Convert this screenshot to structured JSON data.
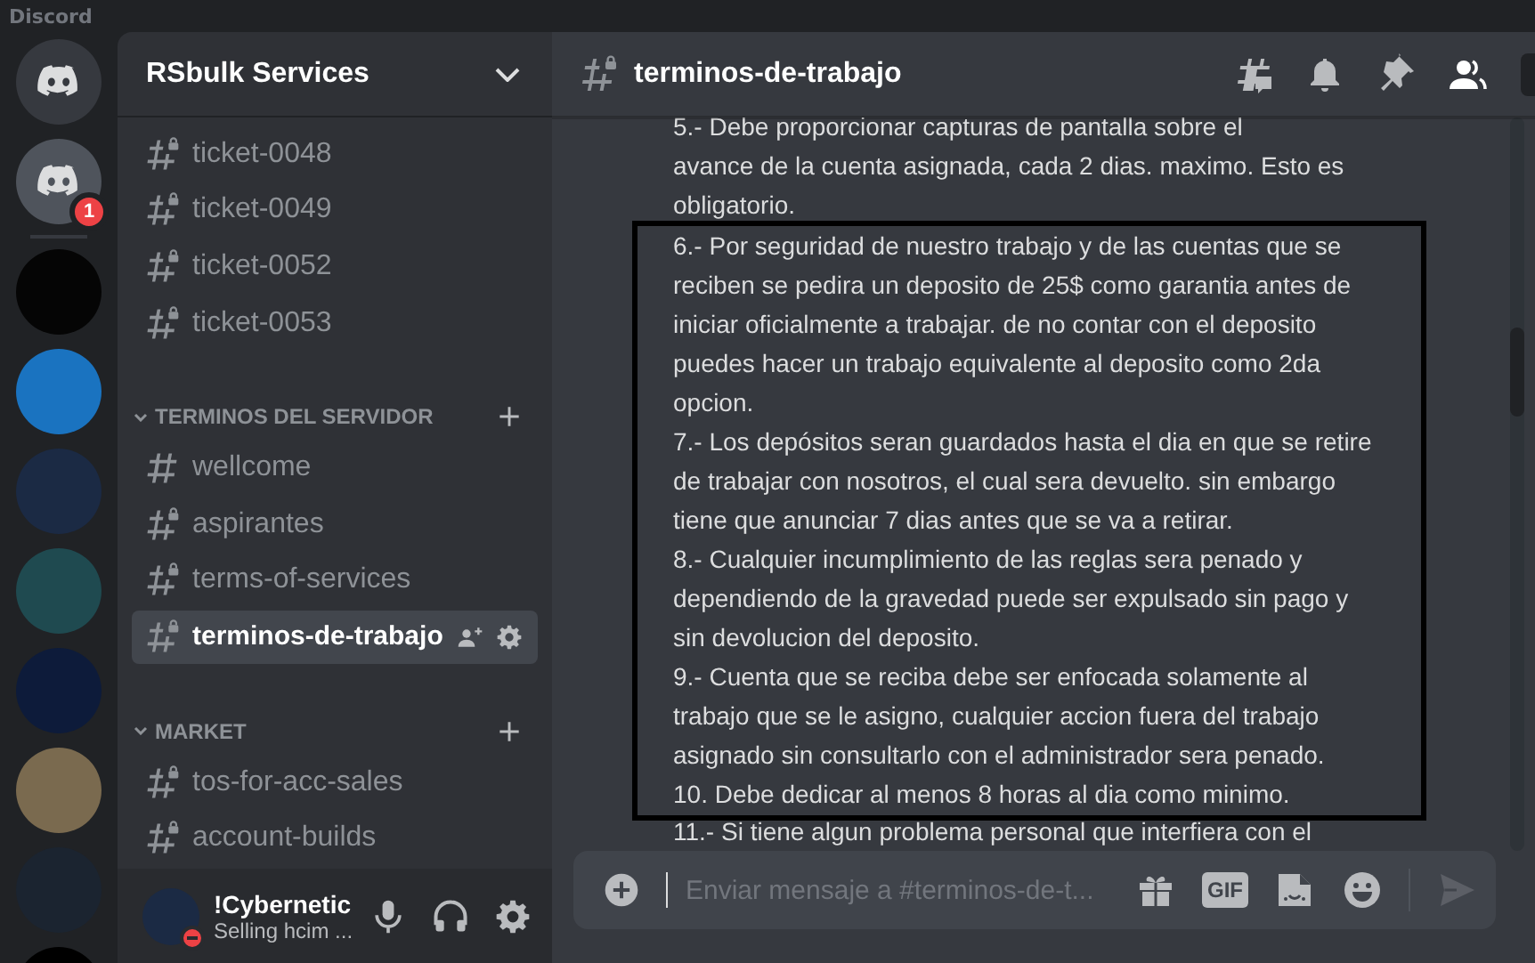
{
  "app": {
    "title": "Discord"
  },
  "servers": [
    {
      "kind": "logo"
    },
    {
      "kind": "logo",
      "badge": "1"
    },
    {
      "kind": "separator"
    },
    {
      "kind": "picture",
      "color": "#050505"
    },
    {
      "kind": "picture",
      "color": "#1a73c0"
    },
    {
      "kind": "picture",
      "color": "#1b2a44"
    },
    {
      "kind": "picture",
      "color": "#1f4a50"
    },
    {
      "kind": "picture",
      "color": "#0d1b3a"
    },
    {
      "kind": "picture",
      "color": "#7a6a4f"
    },
    {
      "kind": "picture",
      "color": "#1b2430"
    },
    {
      "kind": "picture",
      "color": "#000000"
    }
  ],
  "sidebar": {
    "server_name": "RSbulk Services",
    "groups": [
      {
        "channels": [
          {
            "name": "ticket-0048",
            "locked": true,
            "selected": false
          },
          {
            "name": "ticket-0049",
            "locked": true,
            "selected": false
          },
          {
            "name": "ticket-0052",
            "locked": true,
            "selected": false
          },
          {
            "name": "ticket-0053",
            "locked": true,
            "selected": false
          }
        ]
      },
      {
        "category": "TERMINOS DEL SERVIDOR",
        "expanded": true,
        "channels": [
          {
            "name": "wellcome",
            "locked": false,
            "selected": false
          },
          {
            "name": "aspirantes",
            "locked": true,
            "selected": false
          },
          {
            "name": "terms-of-services",
            "locked": true,
            "selected": false
          },
          {
            "name": "terminos-de-trabajo",
            "locked": true,
            "selected": true
          }
        ]
      },
      {
        "category": "MARKET",
        "expanded": true,
        "channels": [
          {
            "name": "tos-for-acc-sales",
            "locked": true,
            "selected": false
          },
          {
            "name": "account-builds",
            "locked": true,
            "selected": false
          }
        ]
      }
    ],
    "user": {
      "name": "!Cybernetic",
      "status_text": "Selling hcim ...",
      "do_not_disturb": true
    }
  },
  "chat": {
    "channel": "terminos-de-trabajo",
    "locked": true,
    "message_groups": [
      {
        "highlighted": false,
        "paragraphs": [
          {
            "lines": [
              "5.- Debe proporcionar capturas de pantalla sobre el",
              "avance de la cuenta asignada, cada 2 dias. maximo. Esto es",
              "obligatorio."
            ]
          }
        ]
      },
      {
        "highlighted": true,
        "paragraphs": [
          {
            "lines": [
              "6.- Por seguridad de nuestro trabajo y de las cuentas que se",
              "reciben se pedira un deposito de 25$ como garantia antes de",
              "iniciar oficialmente a trabajar.  de no contar con el deposito",
              "puedes hacer un trabajo equivalente al deposito como 2da",
              "opcion."
            ]
          },
          {
            "lines": [
              "7.- Los depósitos seran guardados hasta el dia en que se retire",
              "de trabajar con nosotros, el cual sera devuelto. sin embargo",
              "tiene que anunciar 7 dias antes que se va a retirar."
            ]
          },
          {
            "lines": [
              "8.- Cualquier incumplimiento de las reglas sera penado y",
              "dependiendo de la gravedad puede ser expulsado sin pago y",
              "sin devolucion del deposito."
            ]
          },
          {
            "lines": [
              "9.- Cuenta que se reciba debe ser enfocada solamente al",
              "trabajo que se le asigno, cualquier accion fuera del trabajo",
              "asignado sin consultarlo con el administrador sera penado."
            ]
          },
          {
            "lines": [
              "10. Debe dedicar al menos 8 horas al dia como minimo."
            ]
          }
        ]
      },
      {
        "highlighted": false,
        "paragraphs": [
          {
            "lines": [
              "11.- Si tiene algun problema personal que interfiera con el"
            ]
          }
        ]
      }
    ],
    "composer": {
      "placeholder": "Enviar mensaje a #terminos-de-t...",
      "gif_label": "GIF"
    }
  }
}
